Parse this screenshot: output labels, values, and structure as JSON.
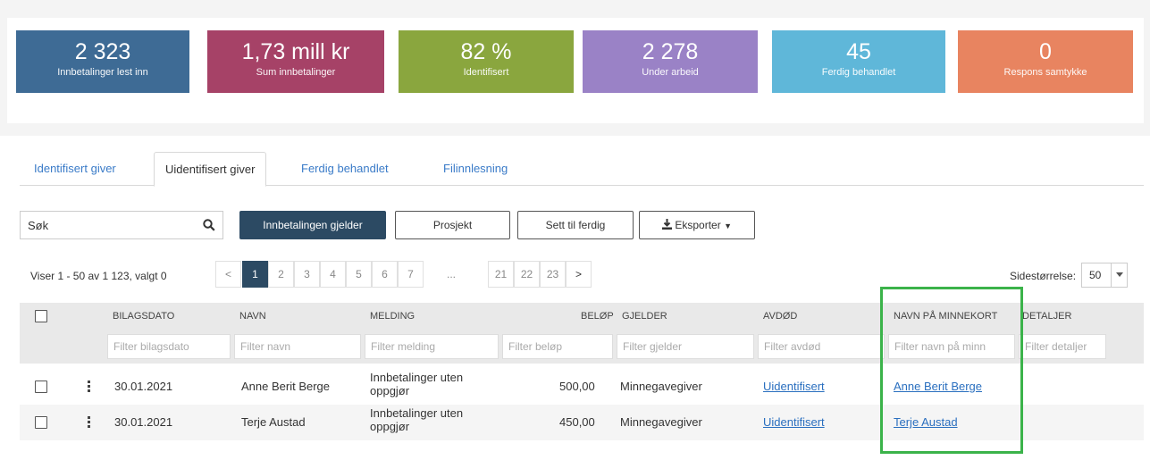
{
  "stats": [
    {
      "value": "2 323",
      "label": "Innbetalinger lest inn",
      "color": "#3e6b95"
    },
    {
      "value": "1,73 mill kr",
      "label": "Sum innbetalinger",
      "color": "#a64267"
    },
    {
      "value": "82 %",
      "label": "Identifisert",
      "color": "#8aa63e"
    },
    {
      "value": "2 278",
      "label": "Under arbeid",
      "color": "#9a82c6"
    },
    {
      "value": "45",
      "label": "Ferdig behandlet",
      "color": "#5fb7d9"
    },
    {
      "value": "0",
      "label": "Respons samtykke",
      "color": "#e88460"
    }
  ],
  "tabs": [
    {
      "label": "Identifisert giver",
      "active": false
    },
    {
      "label": "Uidentifisert giver",
      "active": true
    },
    {
      "label": "Ferdig behandlet",
      "active": false
    },
    {
      "label": "Filinnlesning",
      "active": false
    }
  ],
  "toolbar": {
    "search_value": "Søk",
    "btn_gjelder": "Innbetalingen gjelder",
    "btn_prosjekt": "Prosjekt",
    "btn_ferdig": "Sett til ferdig",
    "btn_eksporter": "Eksporter"
  },
  "pager": {
    "info": "Viser 1 - 50 av 1 123, valgt 0",
    "prev": "<",
    "pages": [
      "1",
      "2",
      "3",
      "4",
      "5",
      "6",
      "7",
      "...",
      "21",
      "22",
      "23"
    ],
    "next": ">",
    "current": "1",
    "pagesize_label": "Sidestørrelse:",
    "pagesize_value": "50"
  },
  "columns": [
    {
      "header": "BILAGSDATO",
      "filter": "Filter bilagsdato"
    },
    {
      "header": "NAVN",
      "filter": "Filter navn"
    },
    {
      "header": "MELDING",
      "filter": "Filter melding"
    },
    {
      "header": "BELØP",
      "filter": "Filter beløp"
    },
    {
      "header": "GJELDER",
      "filter": "Filter gjelder"
    },
    {
      "header": "AVDØD",
      "filter": "Filter avdød"
    },
    {
      "header": "NAVN PÅ MINNEKORT",
      "filter": "Filter navn på minn"
    },
    {
      "header": "DETALJER",
      "filter": "Filter detaljer"
    }
  ],
  "rows": [
    {
      "date": "30.01.2021",
      "name": "Anne Berit Berge",
      "message": "Innbetalinger uten oppgjør",
      "amount": "500,00",
      "gjelder": "Minnegavegiver",
      "avdod": "Uidentifisert",
      "minnekort": "Anne Berit Berge",
      "details": ""
    },
    {
      "date": "30.01.2021",
      "name": "Terje Austad",
      "message": "Innbetalinger uten oppgjør",
      "amount": "450,00",
      "gjelder": "Minnegavegiver",
      "avdod": "Uidentifisert",
      "minnekort": "Terje Austad",
      "details": ""
    }
  ],
  "highlight_color": "#3bb34a"
}
